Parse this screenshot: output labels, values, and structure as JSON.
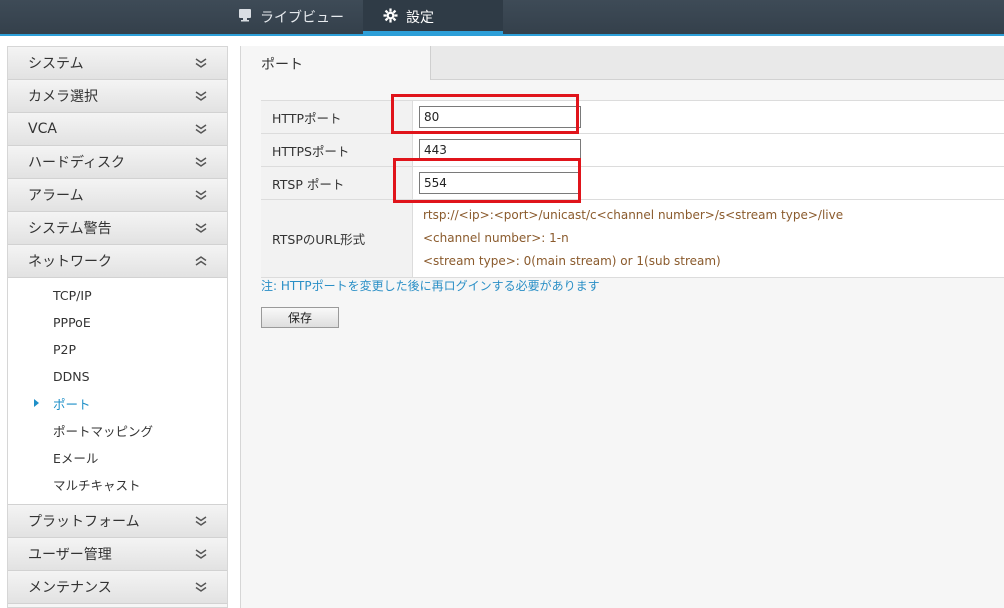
{
  "topbar": {
    "live_icon": "monitor-icon",
    "live_label": "ライブビュー",
    "settings_icon": "gear-icon",
    "settings_label": "設定"
  },
  "sidebar": {
    "menus": [
      {
        "label": "システム",
        "expanded": false
      },
      {
        "label": "カメラ選択",
        "expanded": false
      },
      {
        "label": "VCA",
        "expanded": false
      },
      {
        "label": "ハードディスク",
        "expanded": false
      },
      {
        "label": "アラーム",
        "expanded": false
      },
      {
        "label": "システム警告",
        "expanded": false
      },
      {
        "label": "ネットワーク",
        "expanded": true
      },
      {
        "label": "プラットフォーム",
        "expanded": false
      },
      {
        "label": "ユーザー管理",
        "expanded": false
      },
      {
        "label": "メンテナンス",
        "expanded": false
      }
    ],
    "network_items": [
      "TCP/IP",
      "PPPoE",
      "P2P",
      "DDNS",
      "ポート",
      "ポートマッピング",
      "Eメール",
      "マルチキャスト"
    ],
    "active_item": "ポート"
  },
  "main": {
    "tab_label": "ポート",
    "http_label": "HTTPポート",
    "http_value": "80",
    "https_label": "HTTPSポート",
    "https_value": "443",
    "rtsp_label": "RTSP ポート",
    "rtsp_value": "554",
    "url_label": "RTSPのURL形式",
    "url_lines": [
      "rtsp://<ip>:<port>/unicast/c<channel number>/s<stream type>/live",
      "<channel number>: 1-n",
      "<stream type>: 0(main stream) or 1(sub stream)"
    ],
    "note": "注: HTTPポートを変更した後に再ログインする必要があります",
    "save_label": "保存"
  },
  "colors": {
    "accent": "#2d9fd8",
    "highlight": "#e0141b",
    "topbar": "#3e4b57",
    "url_text": "#8a5a2c"
  }
}
